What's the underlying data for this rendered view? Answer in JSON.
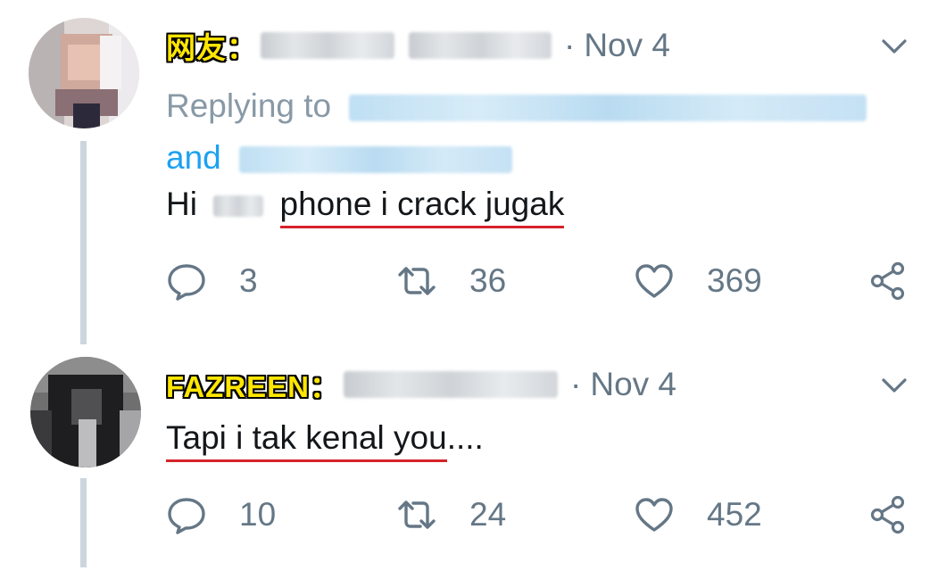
{
  "tweets": [
    {
      "tag": "网友：",
      "date_sep": "·",
      "date": "Nov 4",
      "replying_prefix": "Replying to",
      "replying_and": "and",
      "text_prefix": "Hi",
      "text_underlined": "phone i crack jugak",
      "text_suffix": "",
      "reply_count": "3",
      "retweet_count": "36",
      "like_count": "369"
    },
    {
      "tag": "FAZREEN：",
      "date_sep": "·",
      "date": "Nov 4",
      "text_prefix": "",
      "text_underlined": "Tapi i tak kenal you",
      "text_suffix": "....",
      "reply_count": "10",
      "retweet_count": "24",
      "like_count": "452"
    }
  ],
  "colors": {
    "text": "#14171a",
    "muted": "#657786",
    "link": "#1da1f2",
    "tag_fill": "#ffe600",
    "underline": "#d6232a",
    "thread_line": "#cdd6dd"
  },
  "icons": [
    "chevron-down-icon",
    "reply-icon",
    "retweet-icon",
    "like-icon",
    "share-icon"
  ]
}
